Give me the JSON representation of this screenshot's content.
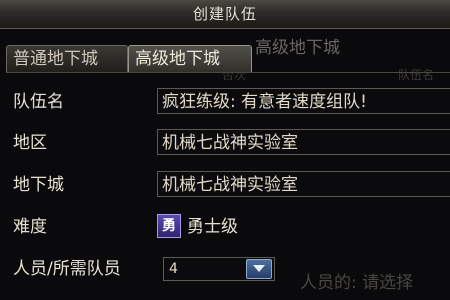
{
  "window": {
    "title": "创建队伍"
  },
  "tabs": [
    {
      "label": "普通地下城",
      "active": false
    },
    {
      "label": "高级地下城",
      "active": true
    }
  ],
  "background": {
    "header": "高级地下城",
    "col_a": "否次",
    "col_b": "队伍名",
    "footer": "人员的: 请选择"
  },
  "form": {
    "party_name": {
      "label": "队伍名",
      "value": "疯狂练级: 有意者速度组队!"
    },
    "region": {
      "label": "地区",
      "value": "机械七战神实验室"
    },
    "dungeon": {
      "label": "地下城",
      "value": "机械七战神实验室"
    },
    "difficulty": {
      "label": "难度",
      "icon_char": "勇",
      "value": "勇士级",
      "icon": "warrior-badge-icon"
    },
    "members": {
      "label": "人员/所需队员",
      "value": "4",
      "icon": "chevron-down-icon"
    }
  },
  "colors": {
    "accent": "#3a5d94",
    "badge": "#4a3aa0"
  }
}
